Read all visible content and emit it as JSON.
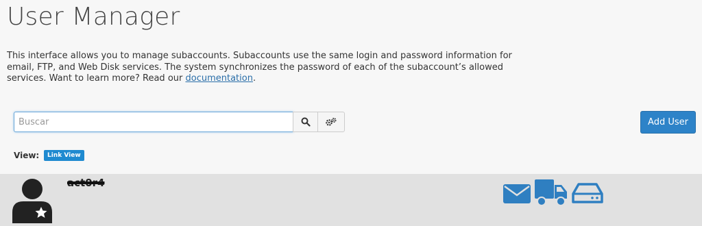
{
  "header": {
    "title": "User Manager"
  },
  "description": {
    "text": "This interface allows you to manage subaccounts. Subaccounts use the same login and password information for email, FTP, and Web Disk services. The system synchronizes the password of each of the subaccount’s allowed services. Want to learn more? Read our ",
    "link_label": "documentation",
    "suffix": "."
  },
  "search": {
    "placeholder": "Buscar",
    "value": ""
  },
  "toolbar": {
    "add_user_label": "Add User"
  },
  "view": {
    "label": "View:",
    "mode": "Link View"
  },
  "users": [
    {
      "username": "act0r4",
      "services": [
        "email-icon",
        "truck-icon",
        "disk-icon"
      ]
    }
  ],
  "colors": {
    "accent": "#2d83c8",
    "service_icon": "#2f7fc1"
  }
}
